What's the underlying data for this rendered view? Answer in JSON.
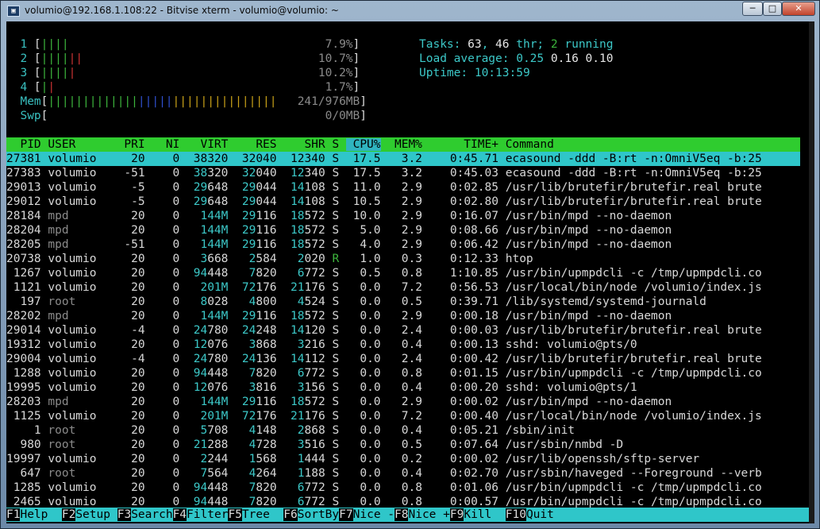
{
  "window": {
    "title": "volumio@192.168.1.108:22 - Bitvise xterm - volumio@volumio: ~",
    "buttons": {
      "minimize": "─",
      "maximize": "□",
      "close": "✕"
    }
  },
  "meters": {
    "cpus": [
      {
        "label": "1",
        "bars": "||||",
        "value": "7.9%"
      },
      {
        "label": "2",
        "bars": "||||||",
        "value": "10.7%"
      },
      {
        "label": "3",
        "bars": "|||||",
        "value": "10.2%"
      },
      {
        "label": "4",
        "bars": "||",
        "value": "1.7%"
      }
    ],
    "mem": {
      "label": "Mem",
      "value": "241/976MB"
    },
    "swp": {
      "label": "Swp",
      "value": "0/0MB"
    }
  },
  "summary": {
    "tasks_label": "Tasks: ",
    "tasks": "63",
    "thr": "46",
    "thr_label": " thr; ",
    "running": "2",
    "running_label": " running",
    "load_label": "Load average: ",
    "load1": "0.25",
    "load5": "0.16",
    "load15": "0.10",
    "uptime_label": "Uptime: ",
    "uptime": "10:13:59"
  },
  "table": {
    "headers": [
      "PID",
      "USER",
      "PRI",
      "NI",
      "VIRT",
      "RES",
      "SHR",
      "S",
      "CPU%",
      "MEM%",
      "TIME+",
      "Command"
    ],
    "rows": [
      [
        "27381",
        "volumio",
        "20",
        "0",
        "38320",
        "32040",
        "12340",
        "S",
        "17.5",
        "3.2",
        "0:45.71",
        "ecasound -ddd -B:rt -n:OmniV5eq -b:25"
      ],
      [
        "27383",
        "volumio",
        "-51",
        "0",
        "38320",
        "32040",
        "12340",
        "S",
        "17.5",
        "3.2",
        "0:45.03",
        "ecasound -ddd -B:rt -n:OmniV5eq -b:25"
      ],
      [
        "29013",
        "volumio",
        "-5",
        "0",
        "29648",
        "29044",
        "14108",
        "S",
        "11.0",
        "2.9",
        "0:02.85",
        "/usr/lib/brutefir/brutefir.real brute"
      ],
      [
        "29012",
        "volumio",
        "-5",
        "0",
        "29648",
        "29044",
        "14108",
        "S",
        "10.5",
        "2.9",
        "0:02.80",
        "/usr/lib/brutefir/brutefir.real brute"
      ],
      [
        "28184",
        "mpd",
        "20",
        "0",
        "144M",
        "29116",
        "18572",
        "S",
        "10.0",
        "2.9",
        "0:16.07",
        "/usr/bin/mpd --no-daemon"
      ],
      [
        "28204",
        "mpd",
        "20",
        "0",
        "144M",
        "29116",
        "18572",
        "S",
        "5.0",
        "2.9",
        "0:08.66",
        "/usr/bin/mpd --no-daemon"
      ],
      [
        "28205",
        "mpd",
        "-51",
        "0",
        "144M",
        "29116",
        "18572",
        "S",
        "4.0",
        "2.9",
        "0:06.42",
        "/usr/bin/mpd --no-daemon"
      ],
      [
        "20738",
        "volumio",
        "20",
        "0",
        "3668",
        "2584",
        "2020",
        "R",
        "1.0",
        "0.3",
        "0:12.33",
        "htop"
      ],
      [
        "1267",
        "volumio",
        "20",
        "0",
        "94448",
        "7820",
        "6772",
        "S",
        "0.5",
        "0.8",
        "1:10.85",
        "/usr/bin/upmpdcli -c /tmp/upmpdcli.co"
      ],
      [
        "1121",
        "volumio",
        "20",
        "0",
        "201M",
        "72176",
        "21176",
        "S",
        "0.0",
        "7.2",
        "0:56.53",
        "/usr/local/bin/node /volumio/index.js"
      ],
      [
        "197",
        "root",
        "20",
        "0",
        "8028",
        "4800",
        "4524",
        "S",
        "0.0",
        "0.5",
        "0:39.71",
        "/lib/systemd/systemd-journald"
      ],
      [
        "28202",
        "mpd",
        "20",
        "0",
        "144M",
        "29116",
        "18572",
        "S",
        "0.0",
        "2.9",
        "0:00.18",
        "/usr/bin/mpd --no-daemon"
      ],
      [
        "29014",
        "volumio",
        "-4",
        "0",
        "24780",
        "24248",
        "14120",
        "S",
        "0.0",
        "2.4",
        "0:00.03",
        "/usr/lib/brutefir/brutefir.real brute"
      ],
      [
        "19312",
        "volumio",
        "20",
        "0",
        "12076",
        "3868",
        "3216",
        "S",
        "0.0",
        "0.4",
        "0:00.13",
        "sshd: volumio@pts/0"
      ],
      [
        "29004",
        "volumio",
        "-4",
        "0",
        "24780",
        "24136",
        "14112",
        "S",
        "0.0",
        "2.4",
        "0:00.42",
        "/usr/lib/brutefir/brutefir.real brute"
      ],
      [
        "1288",
        "volumio",
        "20",
        "0",
        "94448",
        "7820",
        "6772",
        "S",
        "0.0",
        "0.8",
        "0:01.15",
        "/usr/bin/upmpdcli -c /tmp/upmpdcli.co"
      ],
      [
        "19995",
        "volumio",
        "20",
        "0",
        "12076",
        "3816",
        "3156",
        "S",
        "0.0",
        "0.4",
        "0:00.20",
        "sshd: volumio@pts/1"
      ],
      [
        "28203",
        "mpd",
        "20",
        "0",
        "144M",
        "29116",
        "18572",
        "S",
        "0.0",
        "2.9",
        "0:00.02",
        "/usr/bin/mpd --no-daemon"
      ],
      [
        "1125",
        "volumio",
        "20",
        "0",
        "201M",
        "72176",
        "21176",
        "S",
        "0.0",
        "7.2",
        "0:00.40",
        "/usr/local/bin/node /volumio/index.js"
      ],
      [
        "1",
        "root",
        "20",
        "0",
        "5708",
        "4148",
        "2868",
        "S",
        "0.0",
        "0.4",
        "0:05.21",
        "/sbin/init"
      ],
      [
        "980",
        "root",
        "20",
        "0",
        "21288",
        "4728",
        "3516",
        "S",
        "0.0",
        "0.5",
        "0:07.64",
        "/usr/sbin/nmbd -D"
      ],
      [
        "19997",
        "volumio",
        "20",
        "0",
        "2244",
        "1568",
        "1444",
        "S",
        "0.0",
        "0.2",
        "0:00.02",
        "/usr/lib/openssh/sftp-server"
      ],
      [
        "647",
        "root",
        "20",
        "0",
        "7564",
        "4264",
        "1188",
        "S",
        "0.0",
        "0.4",
        "0:02.70",
        "/usr/sbin/haveged --Foreground --verb"
      ],
      [
        "1285",
        "volumio",
        "20",
        "0",
        "94448",
        "7820",
        "6772",
        "S",
        "0.0",
        "0.8",
        "0:01.06",
        "/usr/bin/upmpdcli -c /tmp/upmpdcli.co"
      ],
      [
        "2465",
        "volumio",
        "20",
        "0",
        "94448",
        "7820",
        "6772",
        "S",
        "0.0",
        "0.8",
        "0:00.57",
        "/usr/bin/upmpdcli -c /tmp/upmpdcli.co"
      ]
    ]
  },
  "fkeys": [
    {
      "key": "F1",
      "label": "Help  "
    },
    {
      "key": "F2",
      "label": "Setup "
    },
    {
      "key": "F3",
      "label": "Search"
    },
    {
      "key": "F4",
      "label": "Filter"
    },
    {
      "key": "F5",
      "label": "Tree  "
    },
    {
      "key": "F6",
      "label": "SortBy"
    },
    {
      "key": "F7",
      "label": "Nice -"
    },
    {
      "key": "F8",
      "label": "Nice +"
    },
    {
      "key": "F9",
      "label": "Kill  "
    },
    {
      "key": "F10",
      "label": "Quit"
    }
  ],
  "colors": {
    "header_bg": "#2fcc2f",
    "selected_bg": "#2fc6c9",
    "terminal_bg": "#000000"
  }
}
